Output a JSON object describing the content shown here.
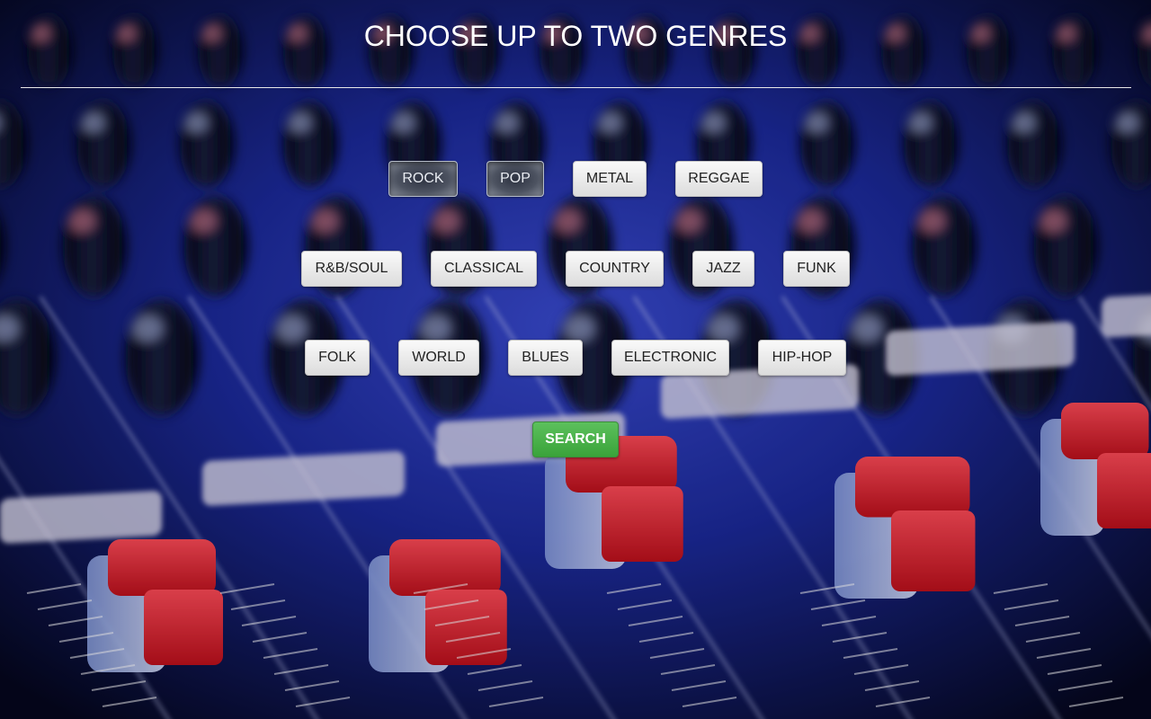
{
  "page": {
    "title": "CHOOSE UP TO TWO GENRES"
  },
  "genres": {
    "row1": [
      {
        "label": "ROCK",
        "selected": true
      },
      {
        "label": "POP",
        "selected": true
      },
      {
        "label": "METAL",
        "selected": false
      },
      {
        "label": "REGGAE",
        "selected": false
      }
    ],
    "row2": [
      {
        "label": "R&B/SOUL",
        "selected": false
      },
      {
        "label": "CLASSICAL",
        "selected": false
      },
      {
        "label": "COUNTRY",
        "selected": false
      },
      {
        "label": "JAZZ",
        "selected": false
      },
      {
        "label": "FUNK",
        "selected": false
      }
    ],
    "row3": [
      {
        "label": "FOLK",
        "selected": false
      },
      {
        "label": "WORLD",
        "selected": false
      },
      {
        "label": "BLUES",
        "selected": false
      },
      {
        "label": "ELECTRONIC",
        "selected": false
      },
      {
        "label": "HIP-HOP",
        "selected": false
      }
    ]
  },
  "actions": {
    "search_label": "SEARCH"
  },
  "colors": {
    "search_green": "#4cae4c",
    "selected_gray": "#4d5361",
    "title_white": "#ffffff",
    "console_blue": "#1a2a8a",
    "fader_red": "#e0242b"
  }
}
